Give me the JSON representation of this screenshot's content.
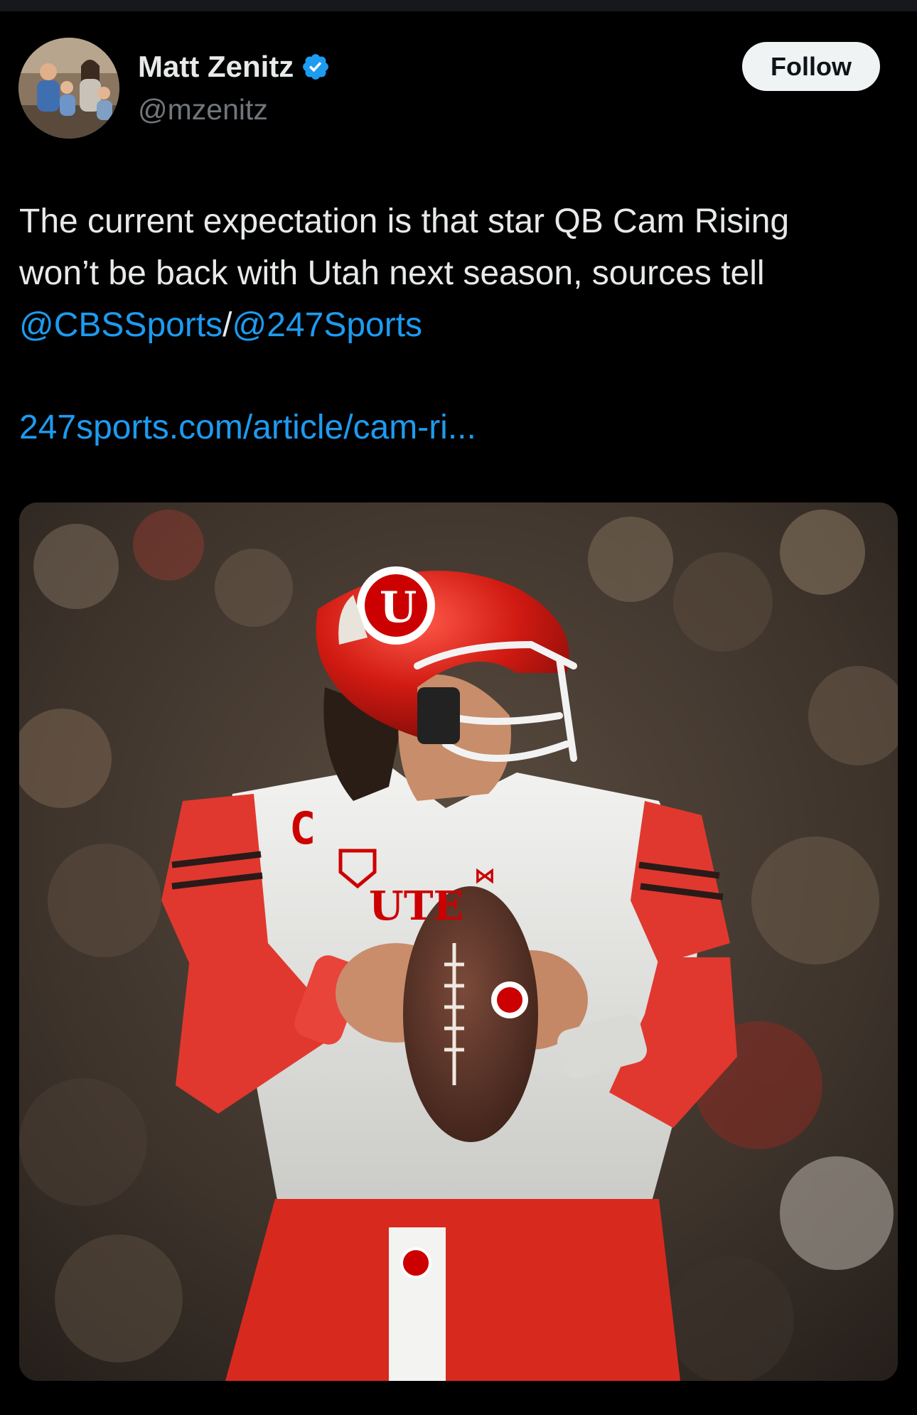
{
  "tweet": {
    "author": {
      "display_name": "Matt Zenitz",
      "handle": "@mzenitz",
      "verified": true,
      "avatar_icon": "family-photo-avatar"
    },
    "follow_label": "Follow",
    "text_lines": [
      "The current expectation is that star QB Cam Rising",
      "won’t be back with Utah next season, sources tell"
    ],
    "mentions": [
      "@CBSSports",
      "@247Sports"
    ],
    "mention_separator": "/",
    "link_text": "247sports.com/article/cam-ri...",
    "media": {
      "type": "photo",
      "description_icon": "football-player-photo",
      "jersey_letters": "UTE",
      "captain_letter": "C"
    }
  },
  "colors": {
    "background": "#000000",
    "text": "#e7e9ea",
    "secondary": "#71767b",
    "link": "#1d9bf0",
    "verified": "#1d9bf0",
    "follow_bg": "#eff3f4",
    "utah_red": "#cc0000"
  }
}
